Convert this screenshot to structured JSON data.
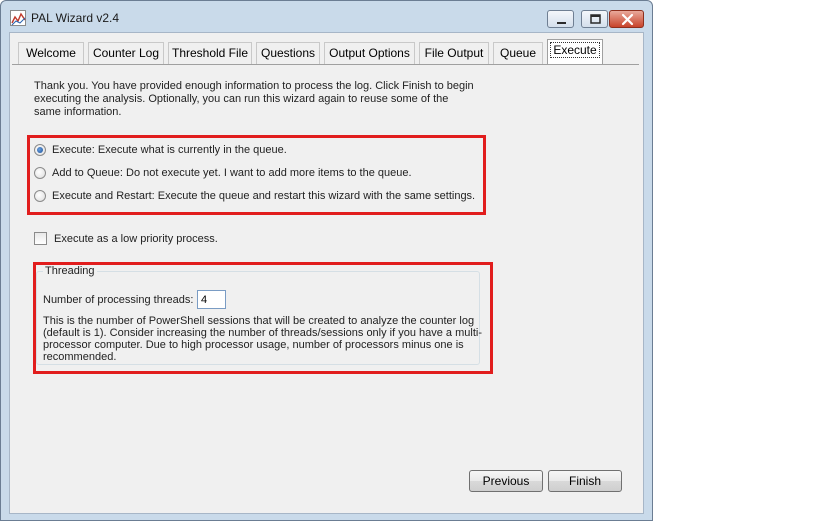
{
  "window": {
    "title": "PAL Wizard v2.4"
  },
  "tabs": [
    {
      "label": "Welcome",
      "active": false
    },
    {
      "label": "Counter Log",
      "active": false
    },
    {
      "label": "Threshold File",
      "active": false
    },
    {
      "label": "Questions",
      "active": false
    },
    {
      "label": "Output Options",
      "active": false
    },
    {
      "label": "File Output",
      "active": false
    },
    {
      "label": "Queue",
      "active": false
    },
    {
      "label": "Execute",
      "active": true
    }
  ],
  "intro": "Thank you. You have provided enough information to process the log. Click Finish to begin executing the analysis. Optionally, you can run this wizard again to reuse some of the same information.",
  "execute_options": [
    {
      "label": "Execute: Execute what is currently in the queue.",
      "checked": true
    },
    {
      "label": "Add to Queue: Do not execute yet. I want to add more items to the queue.",
      "checked": false
    },
    {
      "label": "Execute and Restart: Execute the queue and restart this wizard with the same settings.",
      "checked": false
    }
  ],
  "low_priority": {
    "label": "Execute as a low priority process.",
    "checked": false
  },
  "threading": {
    "legend": "Threading",
    "threads_label": "Number of processing threads:",
    "threads_value": "4",
    "help": "This is the number of PowerShell sessions that will be created to analyze the counter log (default is 1). Consider increasing the number of threads/sessions only if you have a multi-processor computer. Due to high processor usage, number of processors minus one is recommended."
  },
  "buttons": {
    "previous": "Previous",
    "finish": "Finish"
  },
  "icons": {
    "app": "chart-icon",
    "minimize": "minimize-icon",
    "maximize": "maximize-icon",
    "close": "close-icon"
  },
  "colors": {
    "highlight": "#e11d1d",
    "titlebar": "#c9daea",
    "client": "#f0f0f0"
  }
}
